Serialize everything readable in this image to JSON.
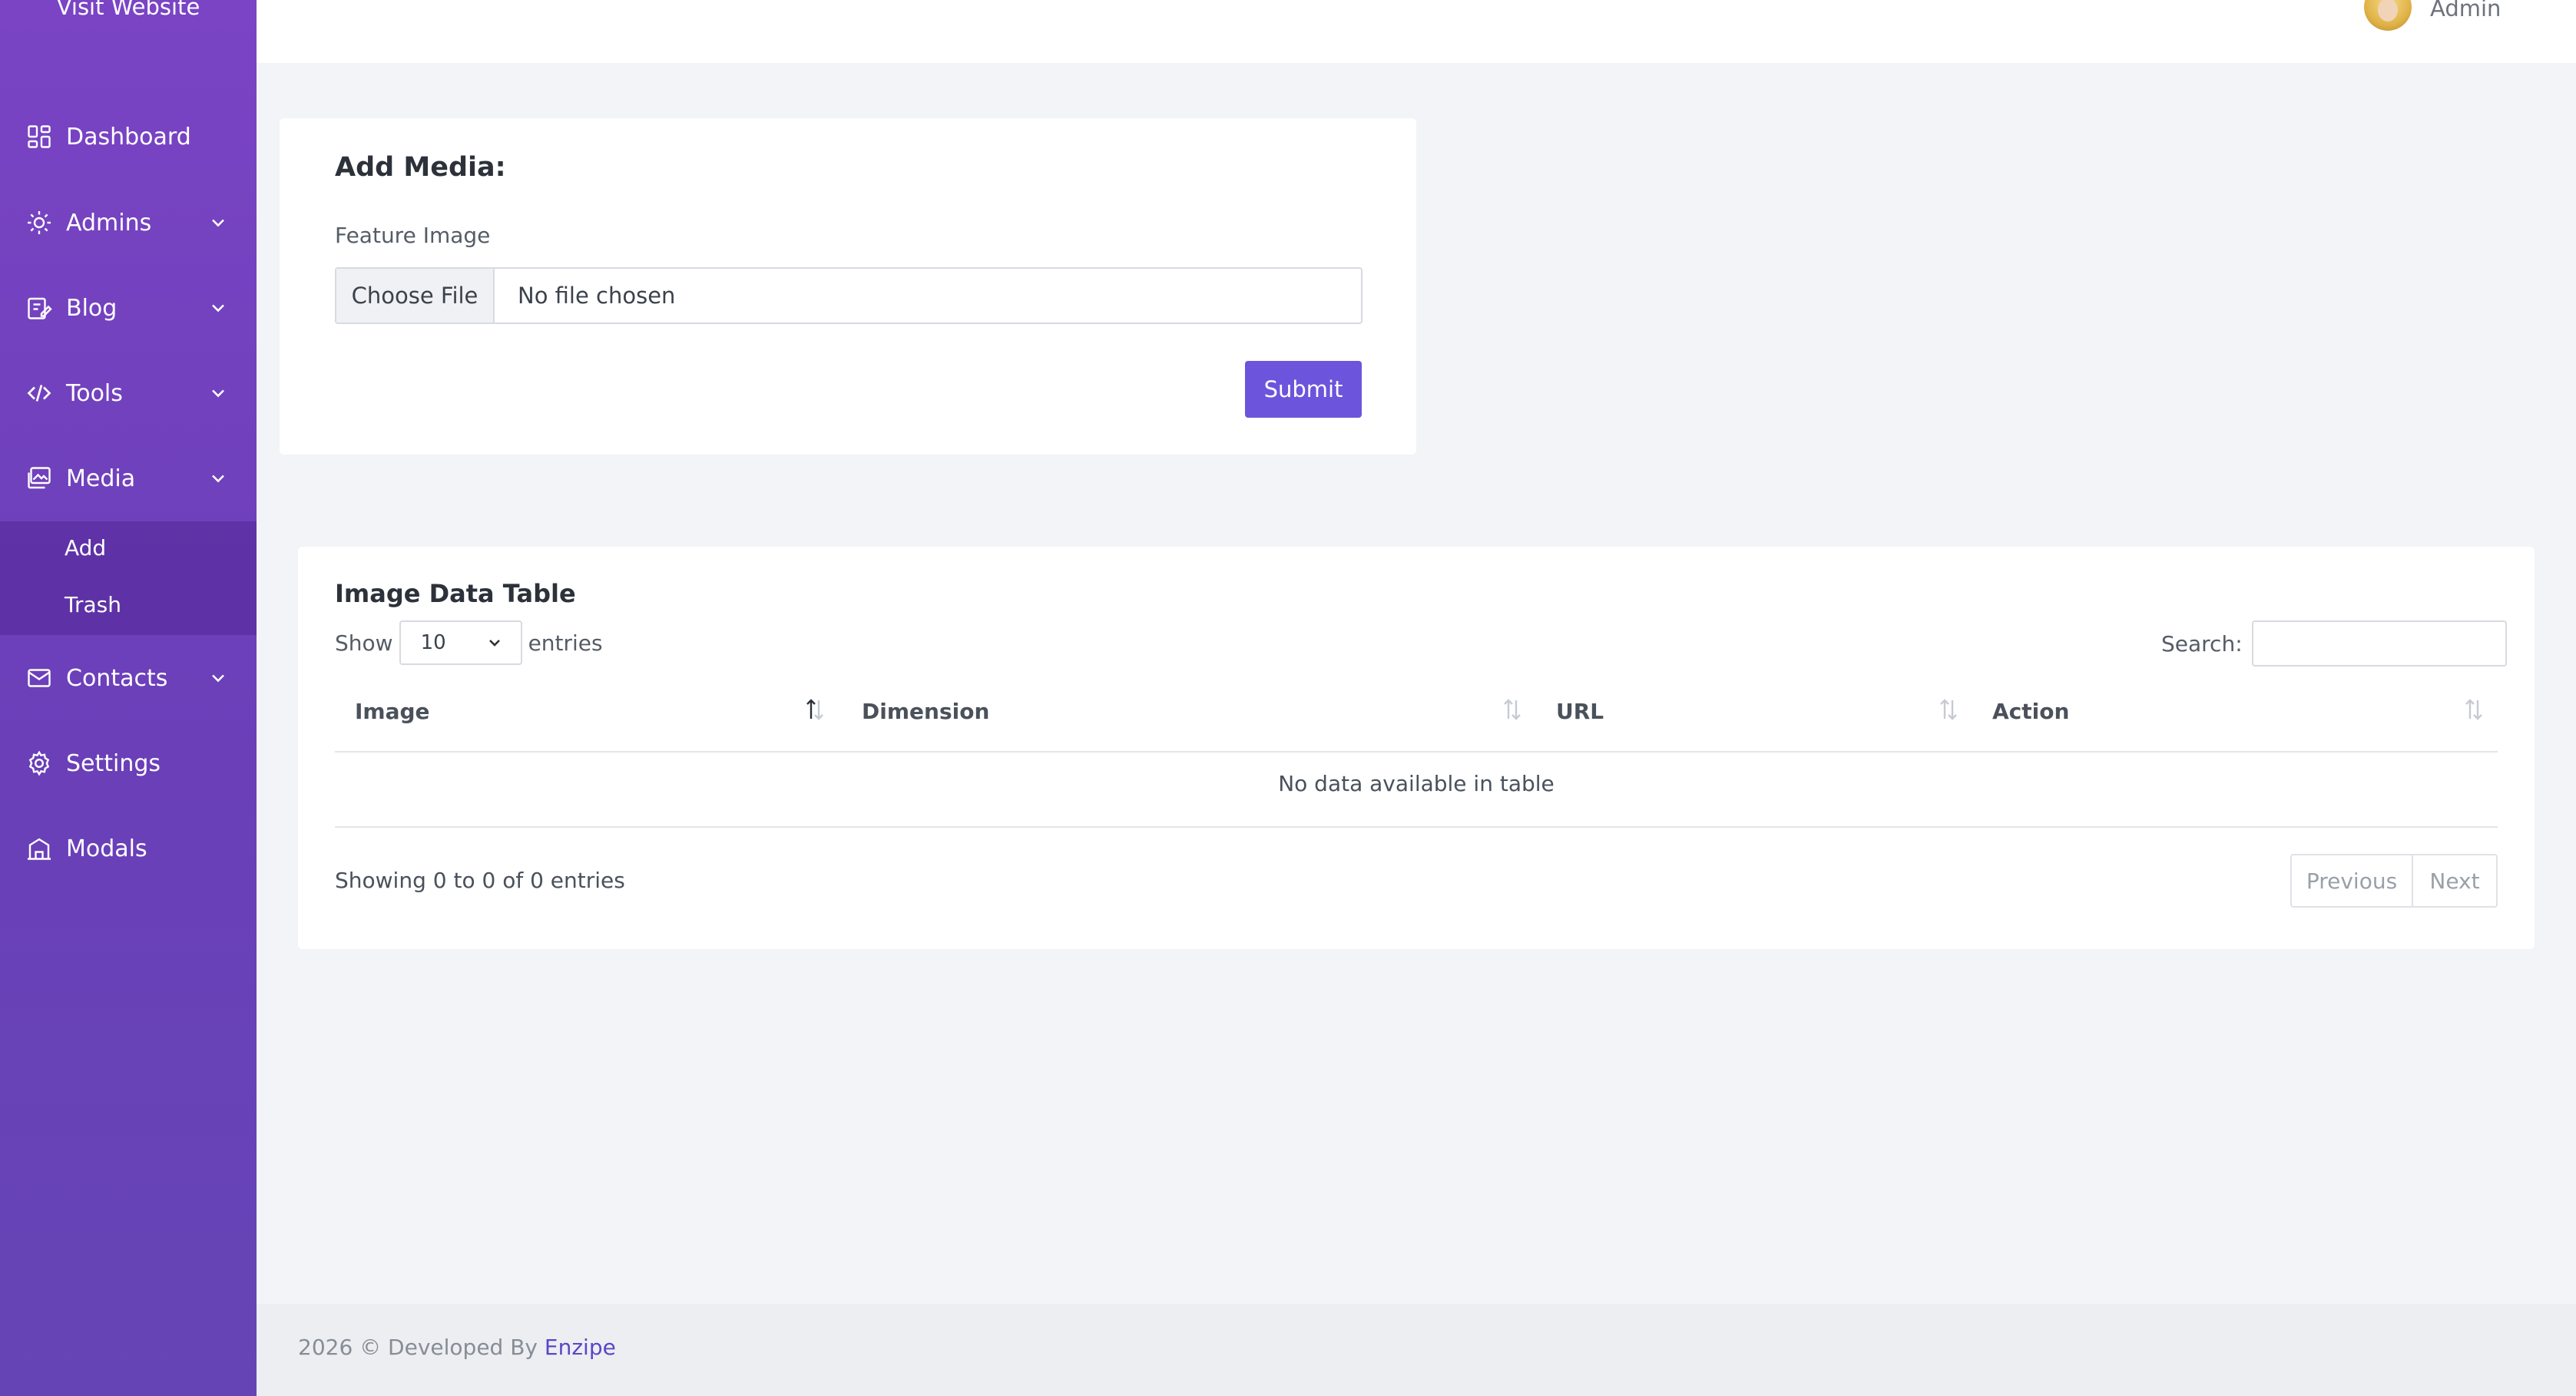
{
  "sidebar": {
    "visit_website": "Visit Website",
    "items": [
      {
        "label": "Dashboard",
        "icon": "dashboard-icon"
      },
      {
        "label": "Admins",
        "icon": "admins-gear-icon"
      },
      {
        "label": "Blog",
        "icon": "blog-edit-icon"
      },
      {
        "label": "Tools",
        "icon": "code-icon"
      },
      {
        "label": "Media",
        "icon": "media-image-icon"
      },
      {
        "label": "Contacts",
        "icon": "mail-icon"
      },
      {
        "label": "Settings",
        "icon": "gear-icon"
      },
      {
        "label": "Modals",
        "icon": "modals-icon"
      }
    ],
    "media_submenu": [
      "Add",
      "Trash"
    ]
  },
  "topbar": {
    "user_name": "Admin"
  },
  "add_media": {
    "title": "Add Media:",
    "field_label": "Feature Image",
    "choose_file": "Choose File",
    "file_status": "No file chosen",
    "submit": "Submit"
  },
  "table": {
    "title": "Image Data Table",
    "show_label": "Show",
    "entries_value": "10",
    "entries_label": "entries",
    "search_label": "Search:",
    "columns": [
      "Image",
      "Dimension",
      "URL",
      "Action"
    ],
    "empty_message": "No data available in table",
    "showing_info": "Showing 0 to 0 of 0 entries",
    "prev": "Previous",
    "next": "Next"
  },
  "footer": {
    "text": "2026 © Developed By ",
    "link": "Enzipe"
  },
  "colors": {
    "sidebar": "#7040c0",
    "accent": "#6c54dc",
    "background": "#f3f4f7"
  }
}
